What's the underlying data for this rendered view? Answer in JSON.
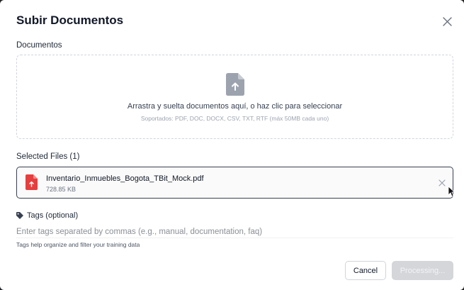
{
  "modal": {
    "title": "Subir Documentos",
    "close_icon": "close-icon"
  },
  "documents": {
    "label": "Documentos",
    "dropzone": {
      "icon": "file-upload-icon",
      "main_text": "Arrastra y suelta documentos aquí, o haz clic para seleccionar",
      "sub_text": "Soportados: PDF, DOC, DOCX, CSV, TXT, RTF (máx 50MB cada uno)"
    }
  },
  "selected_files": {
    "label": "Selected Files (1)",
    "files": [
      {
        "name": "Inventario_Inmuebles_Bogota_TBit_Mock.pdf",
        "size": "728.85 KB",
        "icon": "pdf-file-icon"
      }
    ]
  },
  "tags": {
    "label": "Tags (optional)",
    "icon": "tag-icon",
    "placeholder": "Enter tags separated by commas (e.g., manual, documentation, faq)",
    "value": "",
    "help": "Tags help organize and filter your training data"
  },
  "actions": {
    "cancel_label": "Cancel",
    "submit_label": "Processing..."
  },
  "colors": {
    "pdf_red": "#e53e3e",
    "upload_icon_gray": "#9ca3af",
    "disabled_button": "#d4d6da"
  }
}
